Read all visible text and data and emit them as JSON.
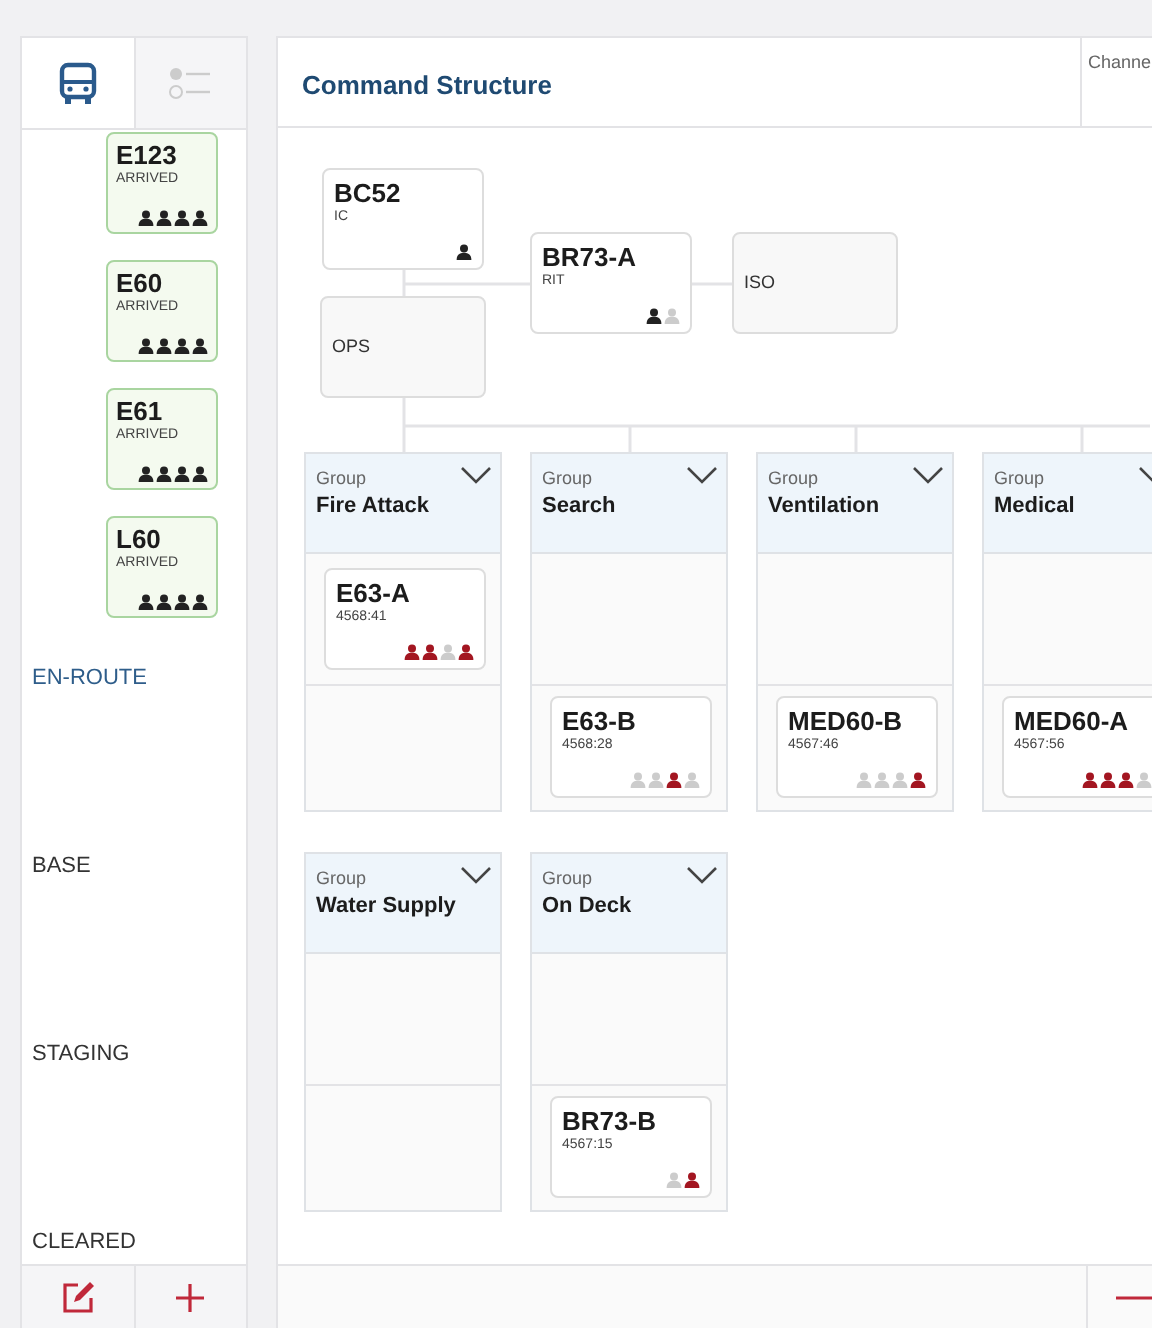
{
  "sidebar": {
    "tabs": [
      {
        "selected": true
      },
      {
        "selected": false
      }
    ],
    "units": [
      {
        "name": "E123",
        "status": "ARRIVED",
        "crew": [
          {
            "color": "#222222"
          },
          {
            "color": "#222222"
          },
          {
            "color": "#222222"
          },
          {
            "color": "#222222"
          }
        ]
      },
      {
        "name": "E60",
        "status": "ARRIVED",
        "crew": [
          {
            "color": "#222222"
          },
          {
            "color": "#222222"
          },
          {
            "color": "#222222"
          },
          {
            "color": "#222222"
          }
        ]
      },
      {
        "name": "E61",
        "status": "ARRIVED",
        "crew": [
          {
            "color": "#222222"
          },
          {
            "color": "#222222"
          },
          {
            "color": "#222222"
          },
          {
            "color": "#222222"
          }
        ]
      },
      {
        "name": "L60",
        "status": "ARRIVED",
        "crew": [
          {
            "color": "#222222"
          },
          {
            "color": "#222222"
          },
          {
            "color": "#222222"
          },
          {
            "color": "#222222"
          }
        ]
      }
    ],
    "sections": [
      {
        "label": "EN-ROUTE",
        "selected": true
      },
      {
        "label": "BASE",
        "selected": false
      },
      {
        "label": "STAGING",
        "selected": false
      },
      {
        "label": "CLEARED",
        "selected": false
      }
    ],
    "footer_buttons": [
      {
        "kind": "edit"
      },
      {
        "kind": "add"
      }
    ]
  },
  "main": {
    "title": "Command Structure",
    "side_header": "Channe",
    "chart": {
      "nodes": [
        {
          "kind": "unit",
          "name": "BC52",
          "role": "IC",
          "crew": [
            {
              "color": "#222222"
            }
          ]
        },
        {
          "kind": "unit",
          "name": "BR73-A",
          "role": "RIT",
          "crew": [
            {
              "color": "#222222"
            },
            {
              "color": "#cccccc"
            }
          ]
        },
        {
          "kind": "position",
          "label": "ISO"
        },
        {
          "kind": "position",
          "label": "OPS"
        }
      ]
    },
    "groups": [
      {
        "caption": "Group",
        "name": "Fire Attack",
        "slots": [
          {
            "kind": "unit",
            "name": "E63-A",
            "time": "4568:41",
            "crew": [
              {
                "color": "#a31621"
              },
              {
                "color": "#a31621"
              },
              {
                "color": "#cccccc"
              },
              {
                "color": "#a31621"
              }
            ]
          },
          {
            "kind": "empty"
          }
        ]
      },
      {
        "caption": "Group",
        "name": "Search",
        "slots": [
          {
            "kind": "empty"
          },
          {
            "kind": "unit",
            "name": "E63-B",
            "time": "4568:28",
            "crew": [
              {
                "color": "#cccccc"
              },
              {
                "color": "#cccccc"
              },
              {
                "color": "#a31621"
              },
              {
                "color": "#cccccc"
              }
            ]
          }
        ]
      },
      {
        "caption": "Group",
        "name": "Ventilation",
        "slots": [
          {
            "kind": "empty"
          },
          {
            "kind": "unit",
            "name": "MED60-B",
            "time": "4567:46",
            "crew": [
              {
                "color": "#cccccc"
              },
              {
                "color": "#cccccc"
              },
              {
                "color": "#cccccc"
              },
              {
                "color": "#a31621"
              }
            ]
          }
        ]
      },
      {
        "caption": "Group",
        "name": "Medical",
        "slots": [
          {
            "kind": "empty"
          },
          {
            "kind": "unit",
            "name": "MED60-A",
            "time": "4567:56",
            "crew": [
              {
                "color": "#a31621"
              },
              {
                "color": "#a31621"
              },
              {
                "color": "#a31621"
              },
              {
                "color": "#cccccc"
              }
            ]
          }
        ]
      },
      {
        "caption": "Group",
        "name": "Water Supply",
        "slots": [
          {
            "kind": "empty"
          },
          {
            "kind": "empty"
          }
        ]
      },
      {
        "caption": "Group",
        "name": "On Deck",
        "slots": [
          {
            "kind": "empty"
          },
          {
            "kind": "unit",
            "name": "BR73-B",
            "time": "4567:15",
            "crew": [
              {
                "color": "#cccccc"
              },
              {
                "color": "#a31621"
              }
            ]
          }
        ]
      }
    ],
    "footer_buttons": [
      {
        "kind": "remove"
      }
    ]
  }
}
